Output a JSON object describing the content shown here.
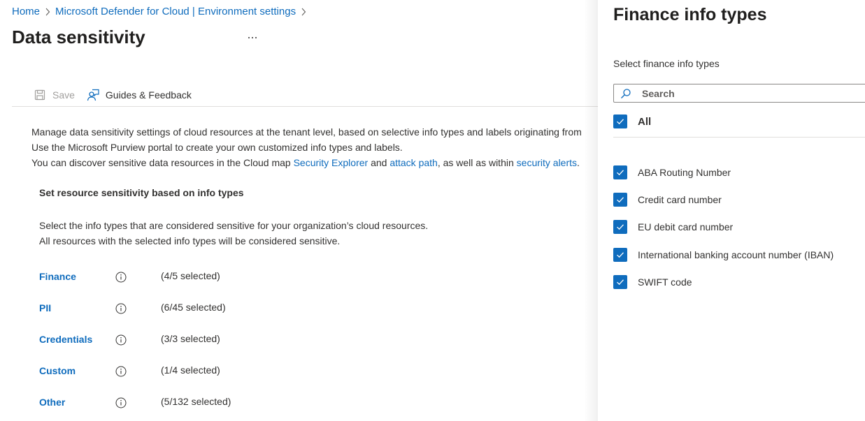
{
  "breadcrumb": {
    "items": [
      "Home",
      "Microsoft Defender for Cloud | Environment settings"
    ]
  },
  "page": {
    "title": "Data sensitivity",
    "more_icon": "ellipsis-icon"
  },
  "toolbar": {
    "save_label": "Save",
    "save_icon": "save-icon",
    "guides_label": "Guides & Feedback",
    "guides_icon": "feedback-person-icon"
  },
  "description": {
    "line1": "Manage data sensitivity settings of cloud resources at the tenant level, based on selective info types and labels originating from",
    "line2": "Use the Microsoft Purview portal to create your own customized info types and labels.",
    "line3_prefix": "You can discover sensitive data resources in the Cloud map ",
    "line3_link1": "Security Explorer",
    "line3_mid": " and ",
    "line3_link2": "attack path",
    "line3_mid2": ", as well as within ",
    "line3_link3": "security alerts",
    "line3_suffix": "."
  },
  "section": {
    "title": "Set resource sensitivity based on info types",
    "desc_line1": "Select the info types that are considered sensitive for your organization’s cloud resources.",
    "desc_line2": "All resources with the selected info types will be considered sensitive."
  },
  "categories": [
    {
      "name": "Finance",
      "count": "(4/5 selected)",
      "icon": "info-icon"
    },
    {
      "name": "PII",
      "count": "(6/45 selected)",
      "icon": "info-icon"
    },
    {
      "name": "Credentials",
      "count": "(3/3 selected)",
      "icon": "info-icon"
    },
    {
      "name": "Custom",
      "count": "(1/4 selected)",
      "icon": "info-icon"
    },
    {
      "name": "Other",
      "count": "(5/132 selected)",
      "icon": "info-icon"
    }
  ],
  "panel": {
    "title": "Finance info types",
    "label": "Select finance info types",
    "search_placeholder": "Search",
    "search_value": "",
    "all_label": "All",
    "all_checked": true,
    "items": [
      {
        "label": "ABA Routing Number",
        "checked": true
      },
      {
        "label": "Credit card number",
        "checked": true
      },
      {
        "label": "EU debit card number",
        "checked": true
      },
      {
        "label": "International banking account number (IBAN)",
        "checked": true
      },
      {
        "label": "SWIFT code",
        "checked": true
      }
    ]
  },
  "colors": {
    "accent": "#0f6cbd",
    "text": "#323130",
    "disabled": "#a19f9d"
  }
}
